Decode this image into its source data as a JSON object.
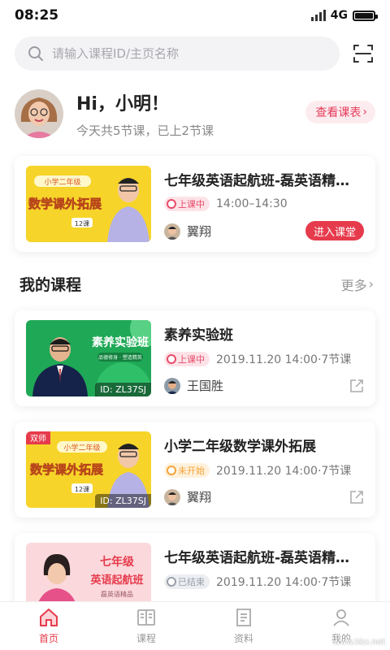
{
  "status_bar": {
    "time": "08:25",
    "network": "4G"
  },
  "search": {
    "placeholder": "请输入课程ID/主页名称"
  },
  "greeting": {
    "title": "Hi，小明！",
    "subtitle": "今天共5节课，已上2节课",
    "view_schedule": "查看课表"
  },
  "today_course": {
    "title": "七年级英语起航班-磊英语精…",
    "status": "上课中",
    "time": "14:00–14:30",
    "teacher": "翼翔",
    "enter_label": "进入课堂",
    "thumb_grade": "小学二年级",
    "thumb_title": "数学课外拓展",
    "thumb_count": "12课"
  },
  "section": {
    "title": "我的课程",
    "more": "更多"
  },
  "courses": [
    {
      "title": "素养实验班",
      "status": "上课中",
      "info": "2019.11.20 14:00·7节课",
      "teacher": "王国胜",
      "thumb_id": "ID: ZL37SJ",
      "thumb_title": "素养实验班",
      "thumb_sub": "品德修身 · 塑造精英"
    },
    {
      "title": "小学二年级数学课外拓展",
      "status": "未开始",
      "info": "2019.11.20 14:00·7节课",
      "teacher": "翼翔",
      "thumb_id": "ID: ZL37SJ",
      "thumb_corner": "双师",
      "thumb_grade": "小学二年级",
      "thumb_title": "数学课外拓展",
      "thumb_count": "12课"
    },
    {
      "title": "七年级英语起航班-磊英语精…",
      "status": "已结束",
      "info": "2019.11.20 14:00·7节课",
      "thumb_title1": "七年级",
      "thumb_title2": "英语起航班",
      "thumb_sub": "磊英语精品"
    }
  ],
  "tabs": [
    {
      "label": "首页",
      "icon": "home-icon",
      "active": true
    },
    {
      "label": "课程",
      "icon": "book-icon"
    },
    {
      "label": "资料",
      "icon": "document-icon"
    },
    {
      "label": "我的",
      "icon": "user-icon"
    }
  ],
  "watermark": "www.kkx.net",
  "colors": {
    "accent": "#e63b4c",
    "live": "#e84a69",
    "waiting": "#f3a338",
    "ended": "#9aa0aa"
  }
}
